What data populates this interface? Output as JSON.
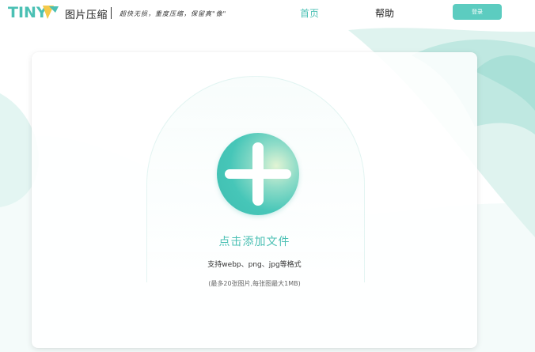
{
  "header": {
    "logo_text": "TINYG",
    "brand_name": "图片压缩",
    "slogan": "超快无损，重度压缩，保留真\"像\"",
    "nav": {
      "home": "首页",
      "help": "帮助"
    },
    "login_label": "登录"
  },
  "upload": {
    "add_label": "点击添加文件",
    "formats": "支持webp、png、jpg等格式",
    "limit": "(最多20张图片,每张图最大1MB)"
  },
  "colors": {
    "accent": "#4bc0b4",
    "button": "#5cccc0",
    "wave": "#cdeee8"
  }
}
